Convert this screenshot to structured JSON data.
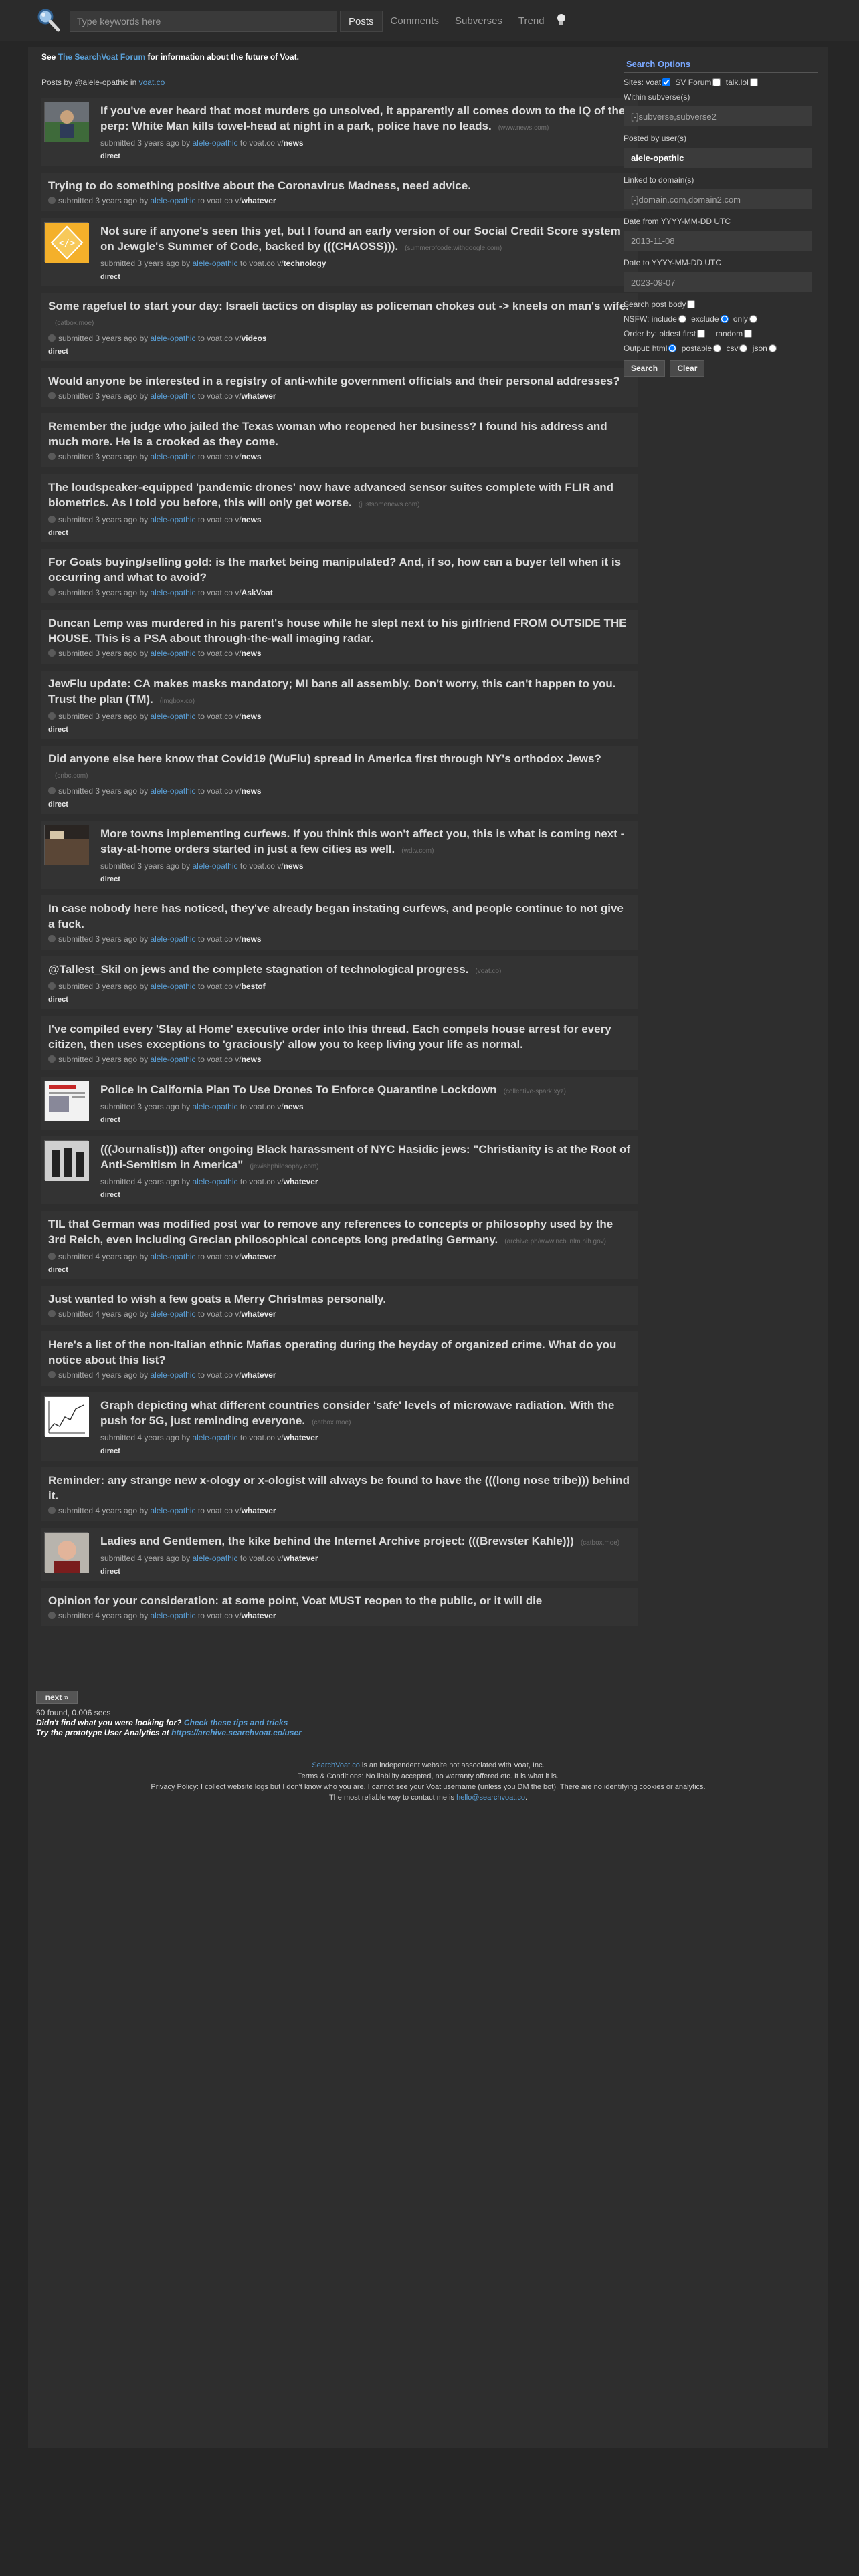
{
  "search": {
    "placeholder": "Type keywords here"
  },
  "nav": {
    "tabs": [
      "Posts",
      "Comments",
      "Subverses",
      "Trend"
    ],
    "active": "Posts"
  },
  "notice": {
    "prefix": "See ",
    "link": "The SearchVoat Forum",
    "suffix": " for information about the future of Voat."
  },
  "posts_by": {
    "prefix": "Posts by @alele-opathic in ",
    "link": "voat.co"
  },
  "posts": [
    {
      "title": "If you've ever heard that most murders go unsolved, it apparently all comes down to the IQ of the perp: White Man kills towel-head at night in a park, police have no leads.",
      "domain": "(www.news.com)",
      "age": "3 years ago",
      "user": "alele-opathic",
      "sub": "news",
      "direct": true,
      "thumb": "photo"
    },
    {
      "title": "Trying to do something positive about the Coronavirus Madness, need advice.",
      "domain": "",
      "age": "3 years ago",
      "user": "alele-opathic",
      "sub": "whatever",
      "direct": false,
      "thumb": ""
    },
    {
      "title": "Not sure if anyone's seen this yet, but I found an early version of our Social Credit Score system on Jewgle's Summer of Code, backed by (((CHAOSS))).",
      "domain": "(summerofcode.withgoogle.com)",
      "age": "3 years ago",
      "user": "alele-opathic",
      "sub": "technology",
      "direct": true,
      "thumb": "gear"
    },
    {
      "title": "Some ragefuel to start your day: Israeli tactics on display as policeman chokes out -> kneels on man's wife.",
      "domain": "(catbox.moe)",
      "age": "3 years ago",
      "user": "alele-opathic",
      "sub": "videos",
      "direct": true,
      "thumb": ""
    },
    {
      "title": "Would anyone be interested in a registry of anti-white government officials and their personal addresses?",
      "domain": "",
      "age": "3 years ago",
      "user": "alele-opathic",
      "sub": "whatever",
      "direct": false,
      "thumb": ""
    },
    {
      "title": "Remember the judge who jailed the Texas woman who reopened her business? I found his address and much more. He is a crooked as they come.",
      "domain": "",
      "age": "3 years ago",
      "user": "alele-opathic",
      "sub": "news",
      "direct": false,
      "thumb": ""
    },
    {
      "title": "The loudspeaker-equipped 'pandemic drones' now have advanced sensor suites complete with FLIR and biometrics. As I told you before, this will only get worse.",
      "domain": "(justsomenews.com)",
      "age": "3 years ago",
      "user": "alele-opathic",
      "sub": "news",
      "direct": true,
      "thumb": ""
    },
    {
      "title": "For Goats buying/selling gold: is the market being manipulated? And, if so, how can a buyer tell when it is occurring and what to avoid?",
      "domain": "",
      "age": "3 years ago",
      "user": "alele-opathic",
      "sub": "AskVoat",
      "direct": false,
      "thumb": ""
    },
    {
      "title": "Duncan Lemp was murdered in his parent's house while he slept next to his girlfriend FROM OUTSIDE THE HOUSE. This is a PSA about through-the-wall imaging radar.",
      "domain": "",
      "age": "3 years ago",
      "user": "alele-opathic",
      "sub": "news",
      "direct": false,
      "thumb": ""
    },
    {
      "title": "JewFlu update: CA makes masks mandatory; MI bans all assembly. Don't worry, this can't happen to you. Trust the plan (TM).",
      "domain": "(imgbox.co)",
      "age": "3 years ago",
      "user": "alele-opathic",
      "sub": "news",
      "direct": true,
      "thumb": ""
    },
    {
      "title": "Did anyone else here know that Covid19 (WuFlu) spread in America first through NY's orthodox Jews?",
      "domain": "(cnbc.com)",
      "age": "3 years ago",
      "user": "alele-opathic",
      "sub": "news",
      "direct": true,
      "thumb": ""
    },
    {
      "title": "More towns implementing curfews. If you think this won't affect you, this is what is coming next - stay-at-home orders started in just a few cities as well.",
      "domain": "(wdtv.com)",
      "age": "3 years ago",
      "user": "alele-opathic",
      "sub": "news",
      "direct": true,
      "thumb": "photo2"
    },
    {
      "title": "In case nobody here has noticed, they've already began instating curfews, and people continue to not give a fuck.",
      "domain": "",
      "age": "3 years ago",
      "user": "alele-opathic",
      "sub": "news",
      "direct": false,
      "thumb": ""
    },
    {
      "title": "@Tallest_Skil on jews and the complete stagnation of technological progress.",
      "domain": "(voat.co)",
      "age": "3 years ago",
      "user": "alele-opathic",
      "sub": "bestof",
      "direct": true,
      "thumb": ""
    },
    {
      "title": "I've compiled every 'Stay at Home' executive order into this thread. Each compels house arrest for every citizen, then uses exceptions to 'graciously' allow you to keep living your life as normal.",
      "domain": "",
      "age": "3 years ago",
      "user": "alele-opathic",
      "sub": "news",
      "direct": false,
      "thumb": ""
    },
    {
      "title": "Police In California Plan To Use Drones To Enforce Quarantine Lockdown",
      "domain": "(collective-spark.xyz)",
      "age": "3 years ago",
      "user": "alele-opathic",
      "sub": "news",
      "direct": true,
      "thumb": "doc"
    },
    {
      "title": "(((Journalist))) after ongoing Black harassment of NYC Hasidic jews: \"Christianity is at the Root of Anti-Semitism in America\"",
      "domain": "(jewishphilosophy.com)",
      "age": "4 years ago",
      "user": "alele-opathic",
      "sub": "whatever",
      "direct": true,
      "thumb": "photo3"
    },
    {
      "title": "TIL that German was modified post war to remove any references to concepts or philosophy used by the 3rd Reich, even including Grecian philosophical concepts long predating Germany.",
      "domain": "(archive.ph/www.ncbi.nlm.nih.gov)",
      "age": "4 years ago",
      "user": "alele-opathic",
      "sub": "whatever",
      "direct": true,
      "thumb": ""
    },
    {
      "title": "Just wanted to wish a few goats a Merry Christmas personally.",
      "domain": "",
      "age": "4 years ago",
      "user": "alele-opathic",
      "sub": "whatever",
      "direct": false,
      "thumb": ""
    },
    {
      "title": "Here's a list of the non-Italian ethnic Mafias operating during the heyday of organized crime. What do you notice about this list?",
      "domain": "",
      "age": "4 years ago",
      "user": "alele-opathic",
      "sub": "whatever",
      "direct": false,
      "thumb": ""
    },
    {
      "title": "Graph depicting what different countries consider 'safe' levels of microwave radiation. With the push for 5G, just reminding everyone.",
      "domain": "(catbox.moe)",
      "age": "4 years ago",
      "user": "alele-opathic",
      "sub": "whatever",
      "direct": true,
      "thumb": "graph"
    },
    {
      "title": "Reminder: any strange new x-ology or x-ologist will always be found to have the (((long nose tribe))) behind it.",
      "domain": "",
      "age": "4 years ago",
      "user": "alele-opathic",
      "sub": "whatever",
      "direct": false,
      "thumb": ""
    },
    {
      "title": "Ladies and Gentlemen, the kike behind the Internet Archive project: (((Brewster Kahle)))",
      "domain": "(catbox.moe)",
      "age": "4 years ago",
      "user": "alele-opathic",
      "sub": "whatever",
      "direct": true,
      "thumb": "face"
    },
    {
      "title": "Opinion for your consideration: at some point, Voat MUST reopen to the public, or it will die",
      "domain": "",
      "age": "4 years ago",
      "user": "alele-opathic",
      "sub": "whatever",
      "direct": false,
      "thumb": ""
    }
  ],
  "labels": {
    "submitted": "submitted",
    "by": "by",
    "to": "to voat.co v/",
    "direct": "direct"
  },
  "next_button": "next »",
  "found": "60 found, 0.006 secs",
  "tips": {
    "prefix": "Didn't find what you were looking for? ",
    "link": "Check these tips and tricks"
  },
  "analytics": {
    "prefix": "Try the prototype User Analytics at ",
    "link": "https://archive.searchvoat.co/user"
  },
  "legal": {
    "line1_link": "SearchVoat.co",
    "line1": " is an independent website not associated with Voat, Inc.",
    "line2": "Terms & Conditions: No liability accepted, no warranty offered etc. It is what it is.",
    "line3": "Privacy Policy: I collect website logs but I don't know who you are. I cannot see your Voat username (unless you DM the bot). There are no identifying cookies or analytics.",
    "line4_prefix": "The most reliable way to contact me is ",
    "line4_link": "hello@searchvoat.co",
    "line4_suffix": "."
  },
  "sidebar": {
    "title": "Search Options",
    "sites_label": "Sites:",
    "site_voat": "voat",
    "site_sv": "SV Forum",
    "site_talk": "talk.lol",
    "within_label": "Within subverse(s)",
    "within_placeholder": "[-]subverse,subverse2",
    "posted_label": "Posted by user(s)",
    "posted_value": "alele-opathic",
    "linked_label": "Linked to domain(s)",
    "linked_placeholder": "[-]domain.com,domain2.com",
    "date_from_label": "Date from YYYY-MM-DD UTC",
    "date_from_placeholder": "2013-11-08",
    "date_to_label": "Date to YYYY-MM-DD UTC",
    "date_to_placeholder": "2023-09-07",
    "search_body": "Search post body",
    "nsfw_label": "NSFW: include",
    "nsfw_exclude": "exclude",
    "nsfw_only": "only",
    "order_label": "Order by: oldest first",
    "order_random": "random",
    "output_label": "Output: html",
    "output_postable": "postable",
    "output_csv": "csv",
    "output_json": "json",
    "search_button": "Search",
    "clear_button": "Clear"
  }
}
